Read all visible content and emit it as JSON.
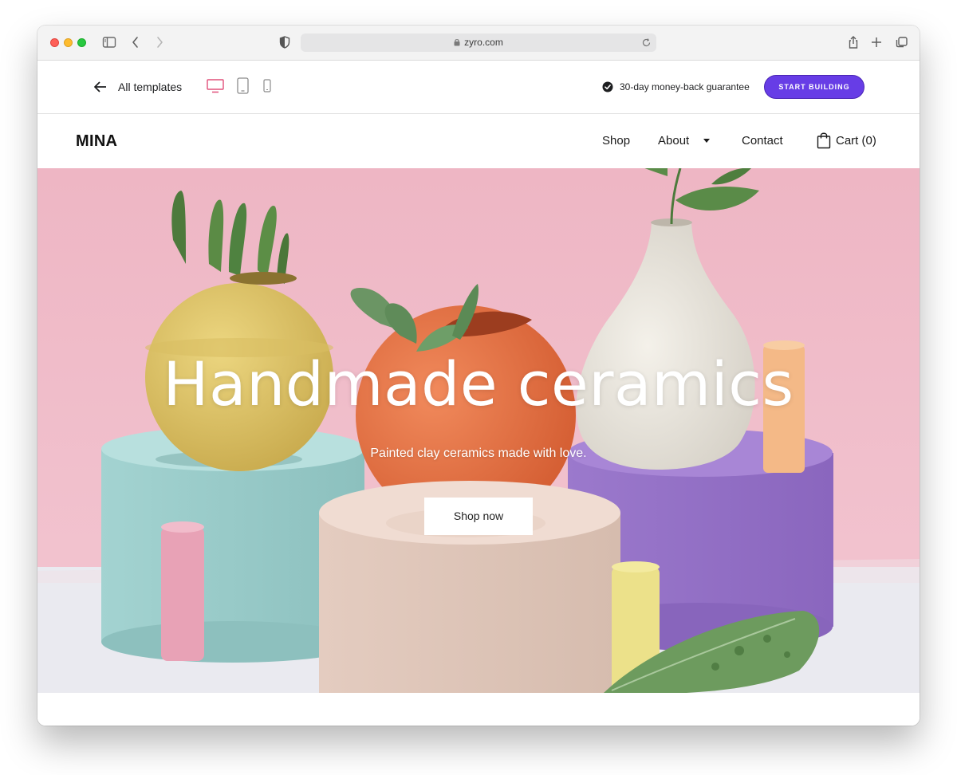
{
  "browser": {
    "url": "zyro.com",
    "icons": [
      "sidebar-icon",
      "back-icon",
      "forward-icon",
      "shield-icon",
      "lock-icon",
      "reload-icon",
      "share-icon",
      "new-tab-icon",
      "tabs-overview-icon"
    ]
  },
  "template_bar": {
    "back_label": "All templates",
    "devices": [
      "desktop-icon",
      "tablet-icon",
      "mobile-icon"
    ],
    "guarantee": "30-day money-back guarantee",
    "cta": "START BUILDING"
  },
  "site": {
    "logo": "MINA",
    "nav": {
      "shop": "Shop",
      "about": "About",
      "contact": "Contact",
      "cart": "Cart (0)"
    }
  },
  "hero": {
    "title": "Handmade ceramics",
    "subtitle": "Painted clay ceramics made with love.",
    "button": "Shop now"
  },
  "colors": {
    "accent": "#673de6",
    "active_device": "#e0507a",
    "hero_background": "#efb8c5"
  }
}
